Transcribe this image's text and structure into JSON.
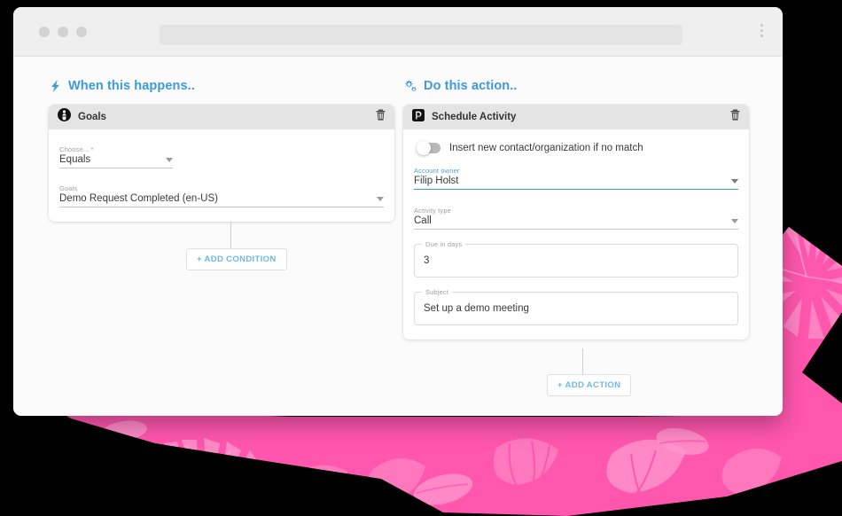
{
  "browser": {
    "traffic_lights": [
      "window-close-dot",
      "window-minimize-dot",
      "window-maximize-dot"
    ],
    "url_value": "",
    "url_placeholder": "",
    "menu_icon": "kebab-menu-icon"
  },
  "colors": {
    "accent_blue": "#3c9bdd",
    "link_blue": "#6cb6e8",
    "pink": "#ff5bb0",
    "pink_light": "#ff8ec9",
    "card_header": "#e4e4e4",
    "canvas": "#fbfbfb",
    "page_background": "#000000"
  },
  "trigger": {
    "heading": "When this happens..",
    "heading_icon": "lightning-bolt-icon",
    "card": {
      "icon": "goals-badge-icon",
      "title": "Goals",
      "delete_icon": "trash-icon",
      "fields": [
        {
          "label": "Choose... *",
          "value": "Equals",
          "type": "select",
          "focused": false,
          "width": "narrow",
          "name": "choose-operator-select"
        },
        {
          "label": "Goals",
          "value": "Demo Request Completed (en-US)",
          "type": "select",
          "focused": false,
          "width": "wide",
          "name": "goals-select"
        }
      ]
    },
    "add_button": "+ ADD CONDITION"
  },
  "action": {
    "heading": "Do this action..",
    "heading_icon": "cogs-icon",
    "card": {
      "icon": "pipedrive-logo-icon",
      "title": "Schedule Activity",
      "delete_icon": "trash-icon",
      "toggle": {
        "label": "Insert new contact/organization if no match",
        "state": "off",
        "name": "insert-new-contact-toggle"
      },
      "fields": [
        {
          "label": "Account owner",
          "value": "Filip Holst",
          "type": "select",
          "focused": true,
          "name": "account-owner-select"
        },
        {
          "label": "Activity type",
          "value": "Call",
          "type": "select",
          "focused": false,
          "name": "activity-type-select"
        },
        {
          "label": "Due in days",
          "value": "3",
          "type": "text",
          "focused": false,
          "name": "due-in-days-input"
        },
        {
          "label": "Subject",
          "value": "Set up a demo meeting",
          "type": "text",
          "focused": false,
          "name": "subject-input"
        }
      ]
    },
    "add_button": "+ ADD ACTION"
  }
}
